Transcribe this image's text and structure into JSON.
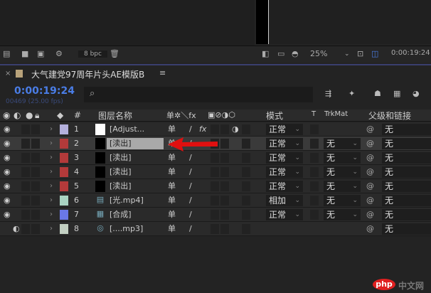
{
  "toolbar": {
    "bpc": "8 bpc",
    "zoom": "25%",
    "timecode": "0:00:19:24"
  },
  "tab": {
    "title": "大气建党97周年片头AE模版B",
    "menu_icon": "≡"
  },
  "timeline": {
    "timecode": "0:00:19:24",
    "frames": "00469 (25.00 fps)",
    "search_icon": "⌕"
  },
  "header": {
    "num": "#",
    "name": "图层名称",
    "switches": "单✲＼fx",
    "mode": "模式",
    "t": "T",
    "trkmat": "TrkMat",
    "parent": "父级和链接"
  },
  "layers": [
    {
      "num": "1",
      "name": "[Adjust...",
      "label": "#b4b0dc",
      "src": "white",
      "mode": "正常",
      "trkmat": "",
      "parent": "无",
      "fx": true
    },
    {
      "num": "2",
      "name": "[渎出]",
      "label": "#b33a3a",
      "src": "black",
      "mode": "正常",
      "trkmat": "无",
      "parent": "无",
      "selected": true
    },
    {
      "num": "3",
      "name": "[渎出]",
      "label": "#b33a3a",
      "src": "black",
      "mode": "正常",
      "trkmat": "无",
      "parent": "无"
    },
    {
      "num": "4",
      "name": "[渎出]",
      "label": "#b33a3a",
      "src": "black",
      "mode": "正常",
      "trkmat": "无",
      "parent": "无"
    },
    {
      "num": "5",
      "name": "[渎出]",
      "label": "#b33a3a",
      "src": "black",
      "mode": "正常",
      "trkmat": "无",
      "parent": "无"
    },
    {
      "num": "6",
      "name": "[光.mp4]",
      "label": "#a9d3c2",
      "src": "file",
      "mode": "相加",
      "trkmat": "无",
      "parent": "无"
    },
    {
      "num": "7",
      "name": "[合成]",
      "label": "#6a78e6",
      "src": "comp",
      "mode": "正常",
      "trkmat": "无",
      "parent": "无"
    },
    {
      "num": "8",
      "name": "[....mp3]",
      "label": "#c2cfc2",
      "src": "audio",
      "mode": "",
      "trkmat": "",
      "parent": "无",
      "audio": true
    }
  ],
  "watermark": {
    "text": "php中文网"
  },
  "colors": {
    "accent": "#4a7de6",
    "arrow": "#e01010"
  }
}
